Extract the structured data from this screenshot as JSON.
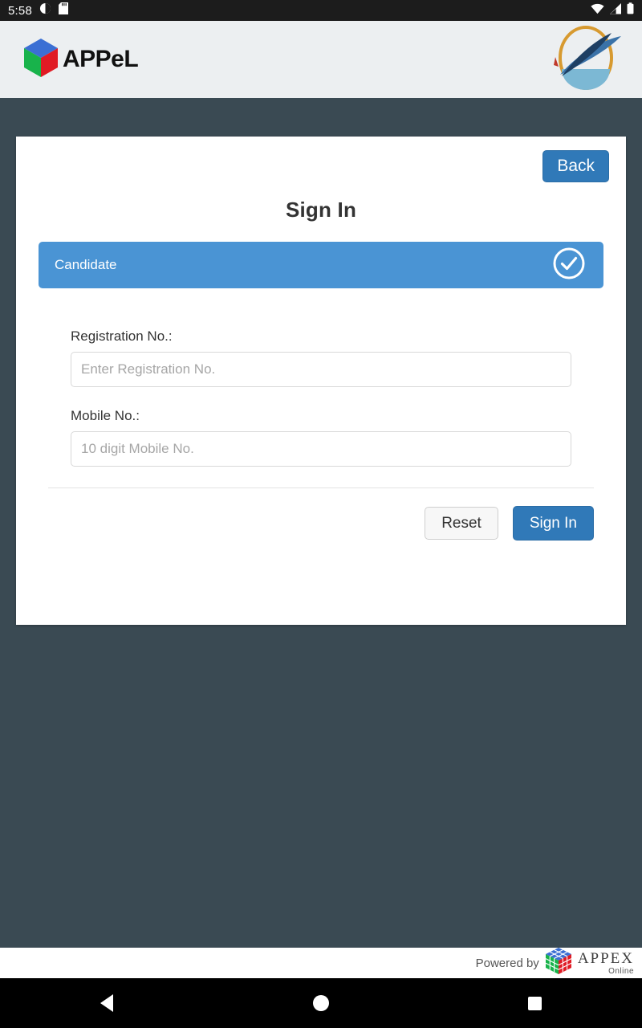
{
  "statusbar": {
    "time": "5:58",
    "icons_left": [
      "do-not-disturb-icon",
      "sd-card-icon"
    ],
    "icons_right": [
      "wifi-icon",
      "cellular-signal-icon",
      "battery-icon"
    ]
  },
  "header": {
    "brand_text": "APPeL",
    "brand_icon": "cube-logo-icon",
    "right_logo": "quill-ellipse-logo-icon"
  },
  "card": {
    "back_label": "Back",
    "title": "Sign In",
    "role": {
      "label": "Candidate",
      "selected_icon": "check-circle-icon",
      "selected": true
    },
    "fields": [
      {
        "name": "registration-no",
        "label": "Registration No.:",
        "placeholder": "Enter Registration No.",
        "value": ""
      },
      {
        "name": "mobile-no",
        "label": "Mobile No.:",
        "placeholder": "10 digit Mobile No.",
        "value": ""
      }
    ],
    "reset_label": "Reset",
    "signin_label": "Sign In"
  },
  "footer": {
    "powered_by": "Powered by",
    "logo_icon": "rubiks-cube-icon",
    "brand": "APPEX",
    "brand_sub": "Online"
  },
  "navbar": {
    "back_icon": "nav-back-triangle-icon",
    "home_icon": "nav-home-circle-icon",
    "recents_icon": "nav-recents-square-icon"
  },
  "colors": {
    "page_background": "#3a4a53",
    "header_background": "#eceff1",
    "card_background": "#ffffff",
    "primary_blue": "#3079b8",
    "role_blue": "#4a94d4",
    "statusbar_background": "#1c1c1c",
    "navbar_background": "#000000"
  }
}
